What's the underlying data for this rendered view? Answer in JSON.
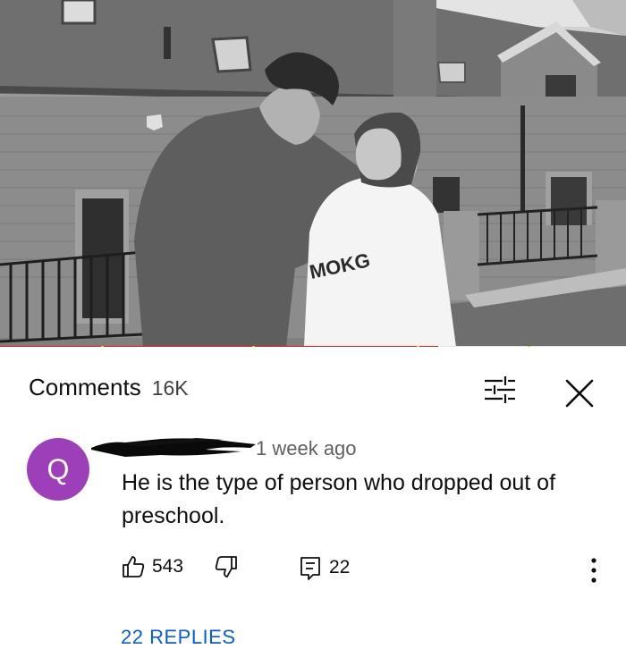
{
  "video": {
    "progress_fraction": 0.7,
    "progress_color": "#e62117",
    "chapter_marker_color": "#f2c500"
  },
  "comments": {
    "title": "Comments",
    "count": "16K",
    "filter_icon": "filter-icon",
    "close_icon": "close-icon"
  },
  "comment": {
    "avatar_letter": "Q",
    "avatar_color": "#9c3fb8",
    "author_redacted": true,
    "timestamp": "1 week ago",
    "text": "He is the type of person who dropped out of preschool.",
    "likes": "543",
    "replies_count": "22",
    "like_icon": "thumbs-up-icon",
    "dislike_icon": "thumbs-down-icon",
    "reply_icon": "comment-icon",
    "more_icon": "more-vertical-icon"
  },
  "replies_link": "22 REPLIES"
}
